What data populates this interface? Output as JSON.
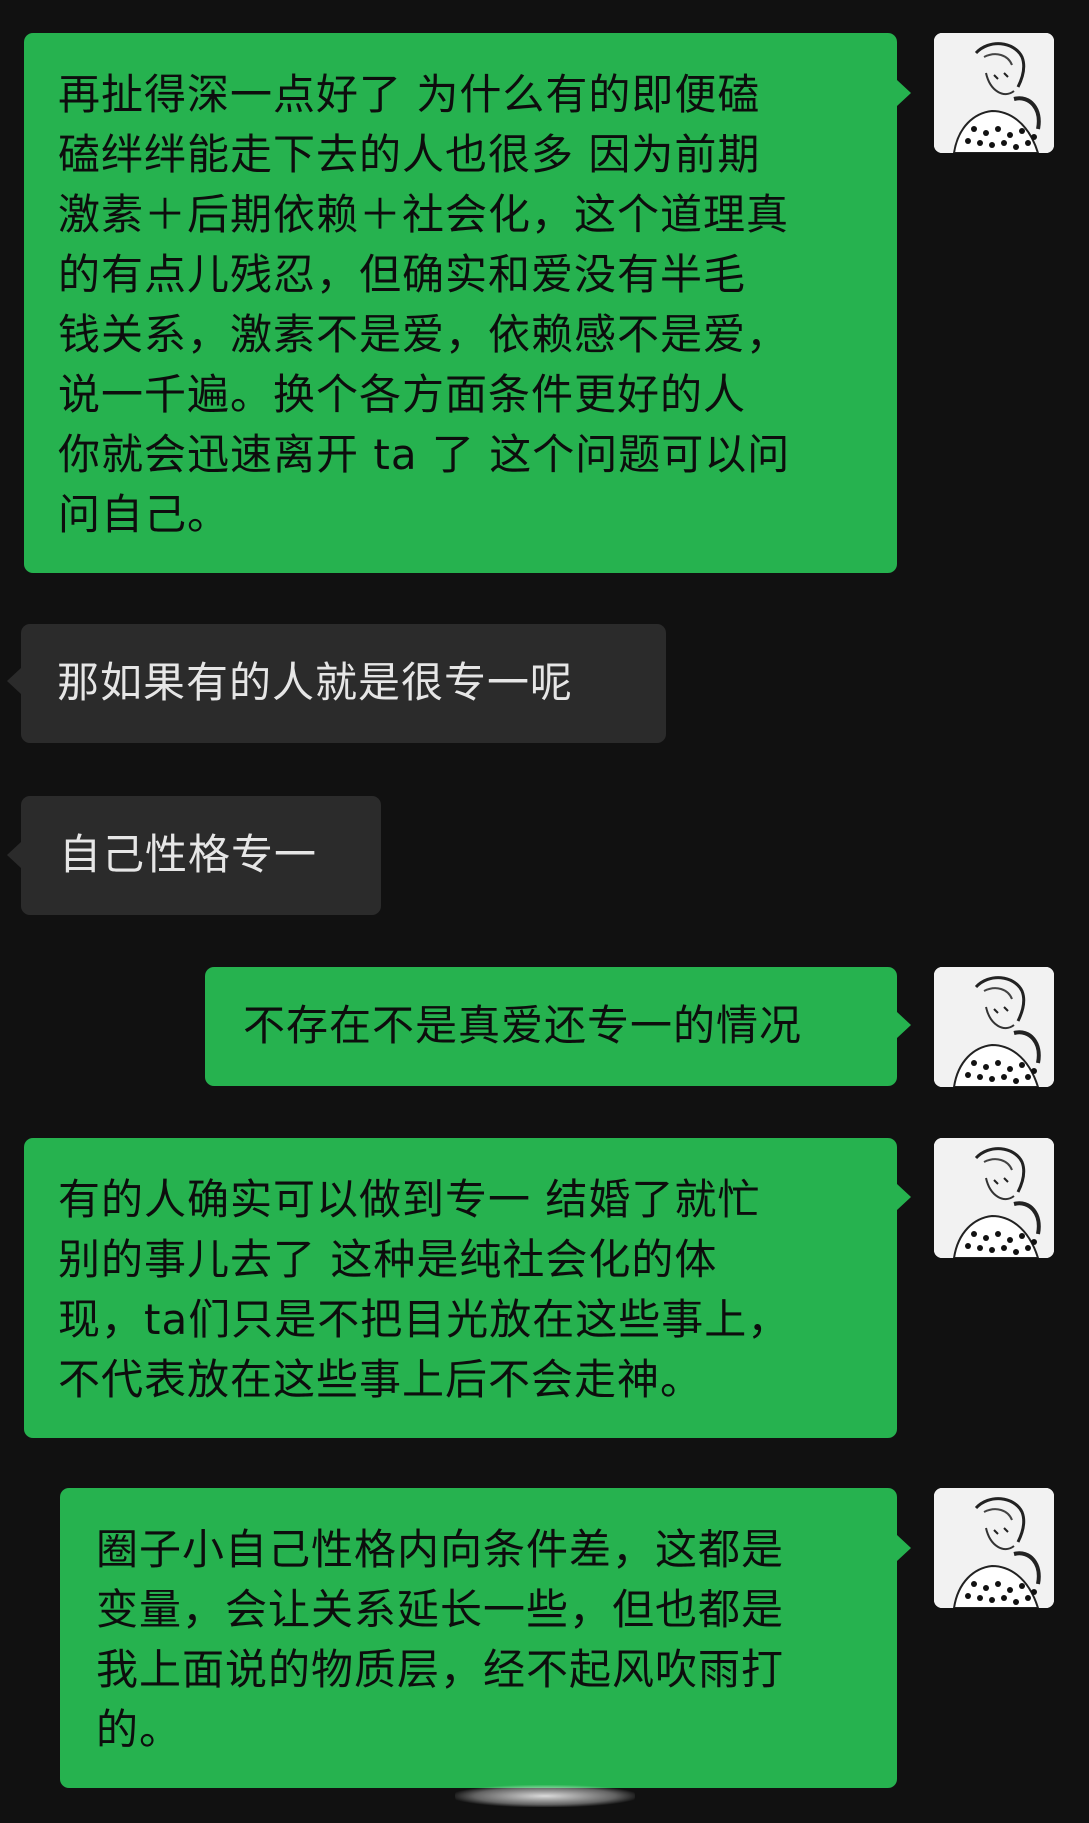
{
  "chat": {
    "messages": [
      {
        "sender": "self",
        "text": "再扯得深一点好了 为什么有的即便磕\n磕绊绊能走下去的人也很多 因为前期\n激素＋后期依赖＋社会化，这个道理真\n的有点儿残忍，但确实和爱没有半毛\n钱关系，激素不是爱，依赖感不是爱，\n说一千遍。换个各方面条件更好的人\n你就会迅速离开 ta 了 这个问题可以问\n问自己。"
      },
      {
        "sender": "other",
        "text": "那如果有的人就是很专一呢"
      },
      {
        "sender": "other",
        "text": "自己性格专一"
      },
      {
        "sender": "self",
        "text": "不存在不是真爱还专一的情况"
      },
      {
        "sender": "self",
        "text": "有的人确实可以做到专一 结婚了就忙\n别的事儿去了 这种是纯社会化的体\n现，ta们只是不把目光放在这些事上，\n不代表放在这些事上后不会走神。"
      },
      {
        "sender": "self",
        "text": "圈子小自己性格内向条件差，这都是\n变量，会让关系延长一些，但也都是\n我上面说的物质层，经不起风吹雨打\n的。"
      }
    ]
  },
  "colors": {
    "background": "#111111",
    "self_bubble": "#26b24f",
    "other_bubble": "#2b2b2b"
  },
  "icons": {
    "self_avatar": "sketch-portrait-avatar"
  }
}
